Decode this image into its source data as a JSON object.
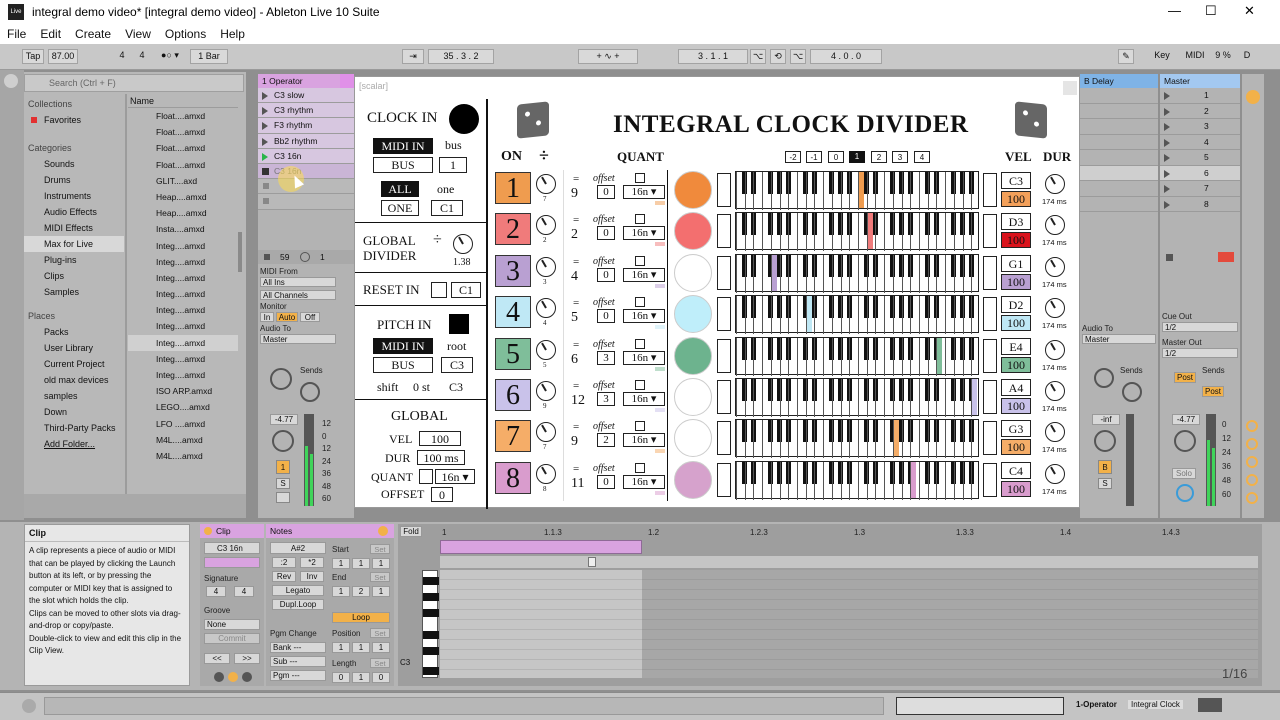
{
  "window": {
    "title": "integral demo video* [integral demo video] - Ableton Live 10 Suite",
    "controls": [
      "—",
      "☐",
      "✕"
    ]
  },
  "menu": [
    "File",
    "Edit",
    "Create",
    "View",
    "Options",
    "Help"
  ],
  "transport": {
    "tap": "Tap",
    "tempo": "87.00",
    "sig_num": "4",
    "sig_den": "4",
    "quant": "1 Bar",
    "position": "35 . 3 . 2",
    "loop_start": "3 . 1 . 1",
    "loop_len": "4 . 0 . 0",
    "key": "Key",
    "midi": "MIDI",
    "cpu": "9 %",
    "d": "D"
  },
  "browser": {
    "search_placeholder": "Search (Ctrl + F)",
    "collections_head": "Collections",
    "favorites": "Favorites",
    "categories_head": "Categories",
    "categories": [
      "Sounds",
      "Drums",
      "Instruments",
      "Audio Effects",
      "MIDI Effects",
      "Max for Live",
      "Plug-ins",
      "Clips",
      "Samples"
    ],
    "places_head": "Places",
    "places": [
      "Packs",
      "User Library",
      "Current Project",
      "old max devices",
      "samples",
      "Down",
      "Third-Party Packs",
      "Add Folder..."
    ],
    "name_col": "Name",
    "files": [
      "Float....amxd",
      "Float....amxd",
      "Float....amxd",
      "Float....amxd",
      "GLIT....axd",
      "Heap....amxd",
      "Heap....amxd",
      "Insta....amxd",
      "Integ....amxd",
      "Integ....amxd",
      "Integ....amxd",
      "Integ....amxd",
      "Integ....amxd",
      "Integ....amxd",
      "Integ....amxd",
      "Integ....amxd",
      "Integ....amxd",
      "ISO ARP.amxd",
      "LEGO....amxd",
      "LFO ....amxd",
      "M4L....amxd",
      "M4L....amxd"
    ]
  },
  "track1": {
    "name": "1 Operator",
    "clips": [
      "C3 slow",
      "C3 rhythm",
      "F3 rhythm",
      "Bb2 rhythm",
      "C3 16n",
      "C3 16n"
    ],
    "midi_from": "MIDI From",
    "all_ins": "All Ins",
    "all_channels": "All Channels",
    "monitor": "Monitor",
    "mon_in": "In",
    "mon_auto": "Auto",
    "mon_off": "Off",
    "audio_to": "Audio To",
    "master": "Master",
    "sends": "Sends",
    "vol": "-4.77",
    "track_no": "1",
    "solo": "S",
    "scale": [
      "12",
      "0",
      "12",
      "24",
      "36",
      "48",
      "60"
    ],
    "stop_count": "59",
    "stop_one": "1"
  },
  "plugin": {
    "header": "[scalar]",
    "clock_in": "CLOCK IN",
    "midi_in": "MIDI IN",
    "bus": "bus",
    "bus_btn": "BUS",
    "bus_val": "1",
    "all": "ALL",
    "one_lbl": "one",
    "one_btn": "ONE",
    "one_val": "C1",
    "global_divider": "GLOBAL\nDIVIDER",
    "div_sym": "÷",
    "div_val": "1.38",
    "reset_in": "RESET IN",
    "reset_val": "C1",
    "pitch_in": "PITCH IN",
    "pitch_midi_in": "MIDI IN",
    "root_lbl": "root",
    "pitch_bus": "BUS",
    "root_val": "C3",
    "shift_lbl": "shift",
    "shift_val": "0 st",
    "shift_note": "C3",
    "global": "GLOBAL",
    "vel_lbl": "VEL",
    "vel_val": "100",
    "dur_lbl": "DUR",
    "dur_val": "100 ms",
    "quant_lbl": "QUANT",
    "quant_val": "16n",
    "offset_lbl": "OFFSET",
    "offset_val": "0",
    "title": "INTEGRAL CLOCK DIVIDER",
    "col_on": "ON",
    "col_div": "÷",
    "col_quant": "QUANT",
    "col_vel": "VEL",
    "col_dur": "DUR",
    "oct_buttons": [
      "-2",
      "-1",
      "0",
      "1",
      "2",
      "3",
      "4"
    ],
    "oct_selected": "1",
    "rows": [
      {
        "n": "1",
        "color": "#ef9c4f",
        "div": "9",
        "knob": "7",
        "offset": "0",
        "quant": "16n",
        "circle": "#f08a3c",
        "note": "C3",
        "vel": "100",
        "vel_color": "#f3a05a",
        "dur": "174 ms"
      },
      {
        "n": "2",
        "color": "#f07b7b",
        "div": "2",
        "knob": "2",
        "offset": "0",
        "quant": "16n",
        "circle": "#f36f6f",
        "note": "D3",
        "vel": "100",
        "vel_color": "#d9131c",
        "dur": "174 ms"
      },
      {
        "n": "3",
        "color": "#b9a0d2",
        "div": "4",
        "knob": "3",
        "offset": "0",
        "quant": "16n",
        "circle": "#ffffff",
        "note": "G1",
        "vel": "100",
        "vel_color": "#b9a0d2",
        "dur": "174 ms"
      },
      {
        "n": "4",
        "color": "#bfe8f5",
        "div": "5",
        "knob": "4",
        "offset": "0",
        "quant": "16n",
        "circle": "#bfeefa",
        "note": "D2",
        "vel": "100",
        "vel_color": "#bfe8f5",
        "dur": "174 ms"
      },
      {
        "n": "5",
        "color": "#7fbe9a",
        "div": "6",
        "knob": "5",
        "offset": "3",
        "quant": "16n",
        "circle": "#6db38e",
        "note": "E4",
        "vel": "100",
        "vel_color": "#7fbe9a",
        "dur": "174 ms"
      },
      {
        "n": "6",
        "color": "#c9c2ea",
        "div": "12",
        "knob": "9",
        "offset": "3",
        "quant": "16n",
        "circle": "#ffffff",
        "note": "A4",
        "vel": "100",
        "vel_color": "#c9c2ea",
        "dur": "174 ms"
      },
      {
        "n": "7",
        "color": "#f5ad68",
        "div": "9",
        "knob": "7",
        "offset": "2",
        "quant": "16n",
        "circle": "#ffffff",
        "note": "G3",
        "vel": "100",
        "vel_color": "#f5ad68",
        "dur": "174 ms"
      },
      {
        "n": "8",
        "color": "#d99ccd",
        "div": "11",
        "knob": "8",
        "offset": "0",
        "quant": "16n",
        "circle": "#d6a2cc",
        "note": "C4",
        "vel": "100",
        "vel_color": "#d99ccd",
        "dur": "174 ms"
      }
    ],
    "eq": "=",
    "offset_small": "offset"
  },
  "right": {
    "b_delay": "B Delay",
    "master": "Master",
    "scenes": [
      "1",
      "2",
      "3",
      "4",
      "5",
      "6",
      "7",
      "8"
    ],
    "audio_to": "Audio To",
    "master_opt": "Master",
    "cue_out": "Cue Out",
    "cue_val": "1/2",
    "master_out": "Master Out",
    "master_out_val": "1/2",
    "sends": "Sends",
    "post": "Post",
    "vol_inf": "-inf",
    "vol_master": "-4.77",
    "b_btn": "B",
    "s_btn": "S",
    "solo": "Solo",
    "scale": [
      "0",
      "12",
      "24",
      "36",
      "48",
      "60"
    ]
  },
  "clip_info": {
    "title": "Clip",
    "text": "A clip represents a piece of audio or MIDI that can be played by clicking the Launch button at its left, or by pressing the computer or MIDI key that is assigned to the slot which holds the clip.\nClips can be moved to other slots via drag-and-drop or copy/paste.\nDouble-click to view and edit this clip in the Clip View."
  },
  "clip_panel": {
    "clip": "Clip",
    "clip_name": "C3 16n",
    "signature": "Signature",
    "sig_num": "4",
    "sig_den": "4",
    "groove": "Groove",
    "groove_val": "None",
    "commit": "Commit",
    "notes": "Notes",
    "note_val": "A#2",
    "div2": ":2",
    "mul2": "*2",
    "rev": "Rev",
    "inv": "Inv",
    "legato": "Legato",
    "dupl": "Dupl.Loop",
    "pgm_change": "Pgm Change",
    "bank": "Bank ---",
    "sub": "Sub ---",
    "pgm": "Pgm ---",
    "start": "Start",
    "end": "End",
    "set": "Set",
    "loop": "Loop",
    "position": "Position",
    "length": "Length",
    "start_vals": [
      "1",
      "1",
      "1"
    ],
    "end_vals": [
      "1",
      "2",
      "1"
    ],
    "pos_vals": [
      "1",
      "1",
      "1"
    ],
    "len_vals": [
      "0",
      "1",
      "0"
    ],
    "fold": "Fold",
    "ruler": [
      "1",
      "1.1.3",
      "1.2",
      "1.2.3",
      "1.3",
      "1.3.3",
      "1.4",
      "1.4.3"
    ],
    "c3": "C3",
    "page": "1/16"
  },
  "status": {
    "track": "1-Operator",
    "device": "Integral Clock"
  }
}
